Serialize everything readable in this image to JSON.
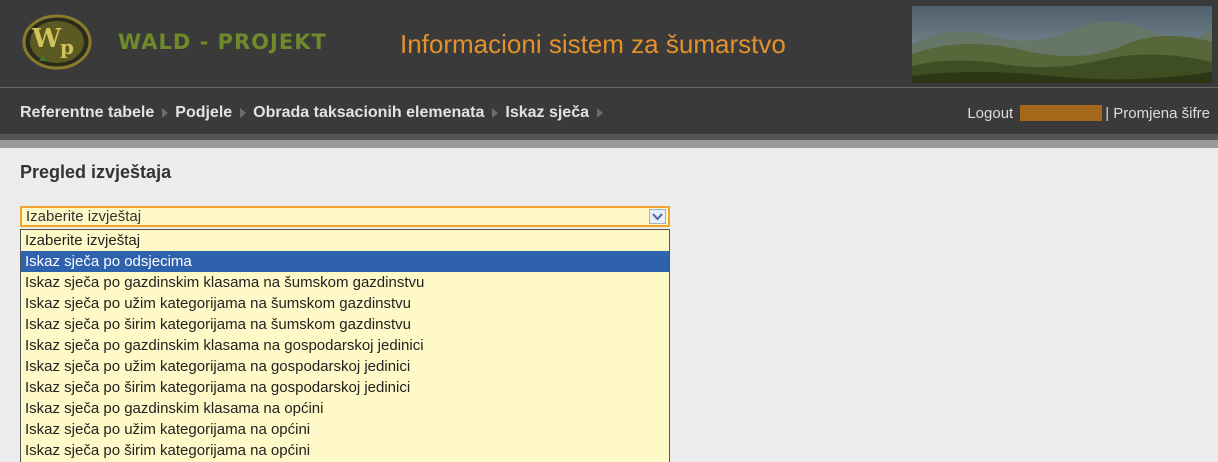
{
  "header": {
    "logo_text": "Wp",
    "brand": "WALD - PROJEKT",
    "title": "Informacioni sistem za šumarstvo"
  },
  "nav": {
    "items": [
      "Referentne tabele",
      "Podjele",
      "Obrada taksacionih elemenata",
      "Iskaz sječa"
    ]
  },
  "user": {
    "logout": "Logout",
    "change_password": "| Promjena šifre"
  },
  "page": {
    "title": "Pregled izvještaja"
  },
  "report_select": {
    "value": "Izaberite izvještaj",
    "options": [
      "Izaberite izvještaj",
      "Iskaz sječa po odsjecima",
      "Iskaz sječa po gazdinskim klasama na šumskom gazdinstvu",
      "Iskaz sječa po užim kategorijama na šumskom gazdinstvu",
      "Iskaz sječa po širim kategorijama na šumskom gazdinstvu",
      "Iskaz sječa po gazdinskim klasama na gospodarskoj jedinici",
      "Iskaz sječa po užim kategorijama na gospodarskoj jedinici",
      "Iskaz sječa po širim kategorijama na gospodarskoj jedinici",
      "Iskaz sječa po gazdinskim klasama na općini",
      "Iskaz sječa po užim kategorijama na općini",
      "Iskaz sječa po širim kategorijama na općini"
    ],
    "highlighted": "Iskaz sječa po odsjecima"
  },
  "colors": {
    "header_bg": "#3a3a3a",
    "brand_green": "#6e8a2a",
    "title_orange": "#e3922b",
    "select_bg": "#fff9c8",
    "select_border": "#f0a42e",
    "highlight": "#2f62ad"
  }
}
